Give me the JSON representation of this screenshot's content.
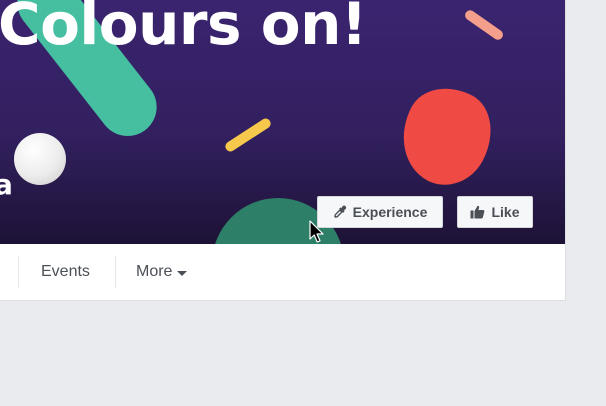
{
  "cover": {
    "title": "Colours on!",
    "name_fragment": "a"
  },
  "actions": {
    "experience_label": "Experience",
    "like_label": "Like"
  },
  "nav": {
    "tabs": [
      {
        "label": "Events"
      },
      {
        "label": "More"
      }
    ]
  },
  "colors": {
    "cover_top": "#3a2470",
    "cover_bottom": "#1d1236",
    "teal": "#46bfa1",
    "red": "#f04a45",
    "yellow": "#f6c94c",
    "pink": "#f49e8c",
    "green": "#2e7f67",
    "page_bg": "#e9ebee"
  },
  "icons": {
    "experience": "eyedropper-icon",
    "like": "thumbs-up-icon",
    "more": "caret-down-icon",
    "pointer": "mouse-cursor-icon"
  }
}
